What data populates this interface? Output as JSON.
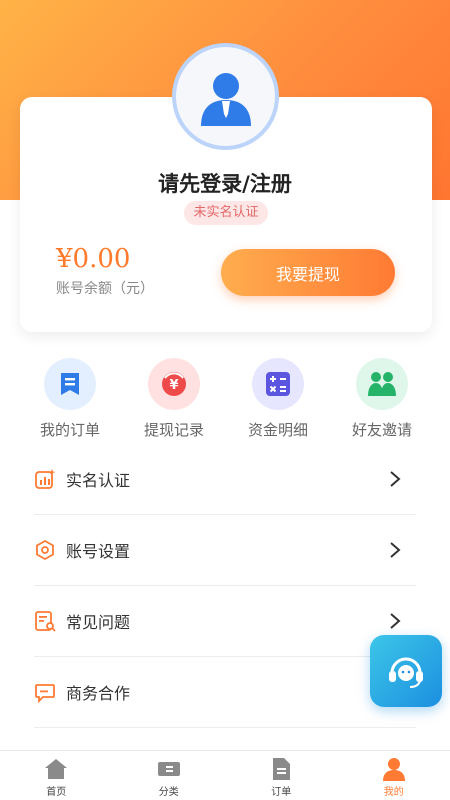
{
  "profile": {
    "login_prompt": "请先登录/注册",
    "verify_status": "未实名认证",
    "balance_amount": "¥0.00",
    "balance_label": "账号余额（元）",
    "withdraw_button": "我要提现"
  },
  "quick_actions": [
    {
      "label": "我的订单",
      "icon": "order-icon"
    },
    {
      "label": "提现记录",
      "icon": "withdraw-record-icon"
    },
    {
      "label": "资金明细",
      "icon": "calculator-icon"
    },
    {
      "label": "好友邀请",
      "icon": "friends-icon"
    }
  ],
  "menu": [
    {
      "label": "实名认证",
      "icon": "verify-chart-icon"
    },
    {
      "label": "账号设置",
      "icon": "settings-icon"
    },
    {
      "label": "常见问题",
      "icon": "faq-icon"
    },
    {
      "label": "商务合作",
      "icon": "chat-icon"
    }
  ],
  "tabbar": [
    {
      "label": "首页",
      "icon": "home-icon"
    },
    {
      "label": "分类",
      "icon": "category-icon"
    },
    {
      "label": "订单",
      "icon": "document-icon"
    },
    {
      "label": "我的",
      "icon": "user-icon",
      "active": true
    }
  ],
  "colors": {
    "accent": "#ff7a33",
    "hero_start": "#ffb347",
    "hero_end": "#ff6a2a",
    "support": "#1c8fe0"
  }
}
